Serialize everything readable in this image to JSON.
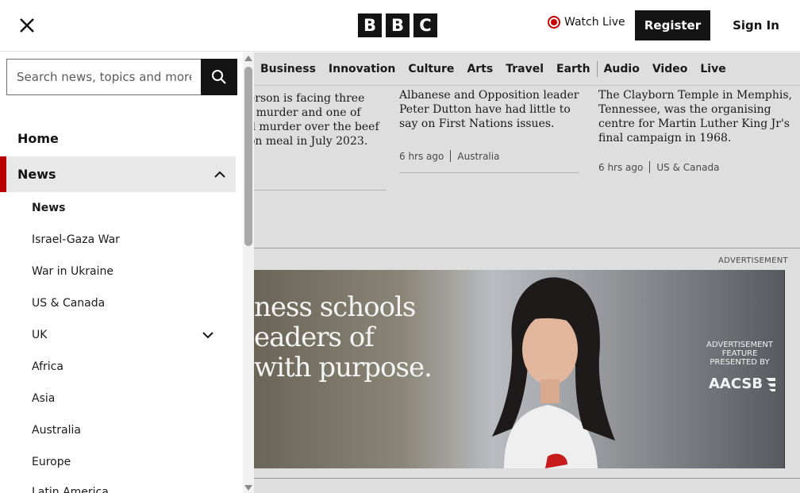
{
  "header": {
    "logo_letters": [
      "B",
      "B",
      "C"
    ],
    "watch_live": "Watch Live",
    "register": "Register",
    "sign_in": "Sign In"
  },
  "nav": {
    "items": [
      "Business",
      "Innovation",
      "Culture",
      "Arts",
      "Travel",
      "Earth"
    ],
    "media_items": [
      "Audio",
      "Video",
      "Live"
    ]
  },
  "articles": [
    {
      "lines": [
        "erson is facing three",
        "f murder and one of",
        "d murder over the beef",
        "on meal in July 2023."
      ]
    },
    {
      "lines": [
        "Albanese and Opposition leader",
        "Peter Dutton have had little to",
        "say on First Nations issues."
      ],
      "time": "6 hrs ago",
      "section": "Australia"
    },
    {
      "lines": [
        "The Clayborn Temple in Memphis,",
        "Tennessee, was the organising",
        "centre for Martin Luther King Jr's",
        "final campaign in 1968."
      ],
      "time": "6 hrs ago",
      "section": "US & Canada"
    }
  ],
  "ad": {
    "label": "ADVERTISEMENT",
    "headline_lines": [
      "ness schools",
      "eaders of",
      "with purpose."
    ],
    "feature_text": "ADVERTISEMENT FEATURE PRESENTED BY",
    "sponsor": "AACSB"
  },
  "sidebar": {
    "search_placeholder": "Search news, topics and more",
    "home": "Home",
    "news": "News",
    "sub_items": [
      "News",
      "Israel-Gaza War",
      "War in Ukraine",
      "US & Canada",
      "UK",
      "Africa",
      "Asia",
      "Australia",
      "Europe",
      "Latin America"
    ]
  },
  "colors": {
    "accent": "#b80000",
    "brand": "#141414",
    "backdrop": "#dedede"
  }
}
